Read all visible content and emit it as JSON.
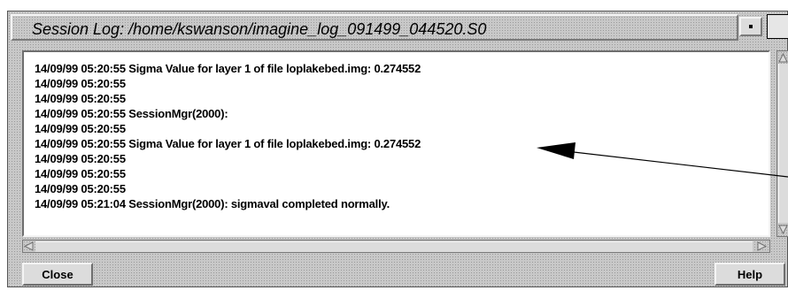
{
  "window": {
    "title": "Session Log: /home/kswanson/imagine_log_091499_044520.S0"
  },
  "log": {
    "lines": [
      "14/09/99 05:20:55 Sigma Value for layer 1 of file loplakebed.img: 0.274552",
      "14/09/99 05:20:55",
      "14/09/99 05:20:55",
      "14/09/99 05:20:55 SessionMgr(2000):",
      "14/09/99 05:20:55",
      "14/09/99 05:20:55 Sigma Value for layer 1 of file loplakebed.img: 0.274552",
      "14/09/99 05:20:55",
      "14/09/99 05:20:55",
      "14/09/99 05:20:55",
      "14/09/99 05:21:04 SessionMgr(2000): sigmaval completed normally."
    ]
  },
  "buttons": {
    "close_label": "Close",
    "help_label": "Help"
  },
  "icons": {
    "minimize": "minimize-icon",
    "maximize": "maximize-icon",
    "scroll_up": "scroll-up-arrow-icon",
    "scroll_down": "scroll-down-arrow-icon",
    "scroll_left": "scroll-left-arrow-icon",
    "scroll_right": "scroll-right-arrow-icon",
    "pointer": "annotation-arrow-icon"
  },
  "colors": {
    "window_bg": "#c8c8c8",
    "text_bg": "#ffffff",
    "text": "#000000"
  }
}
